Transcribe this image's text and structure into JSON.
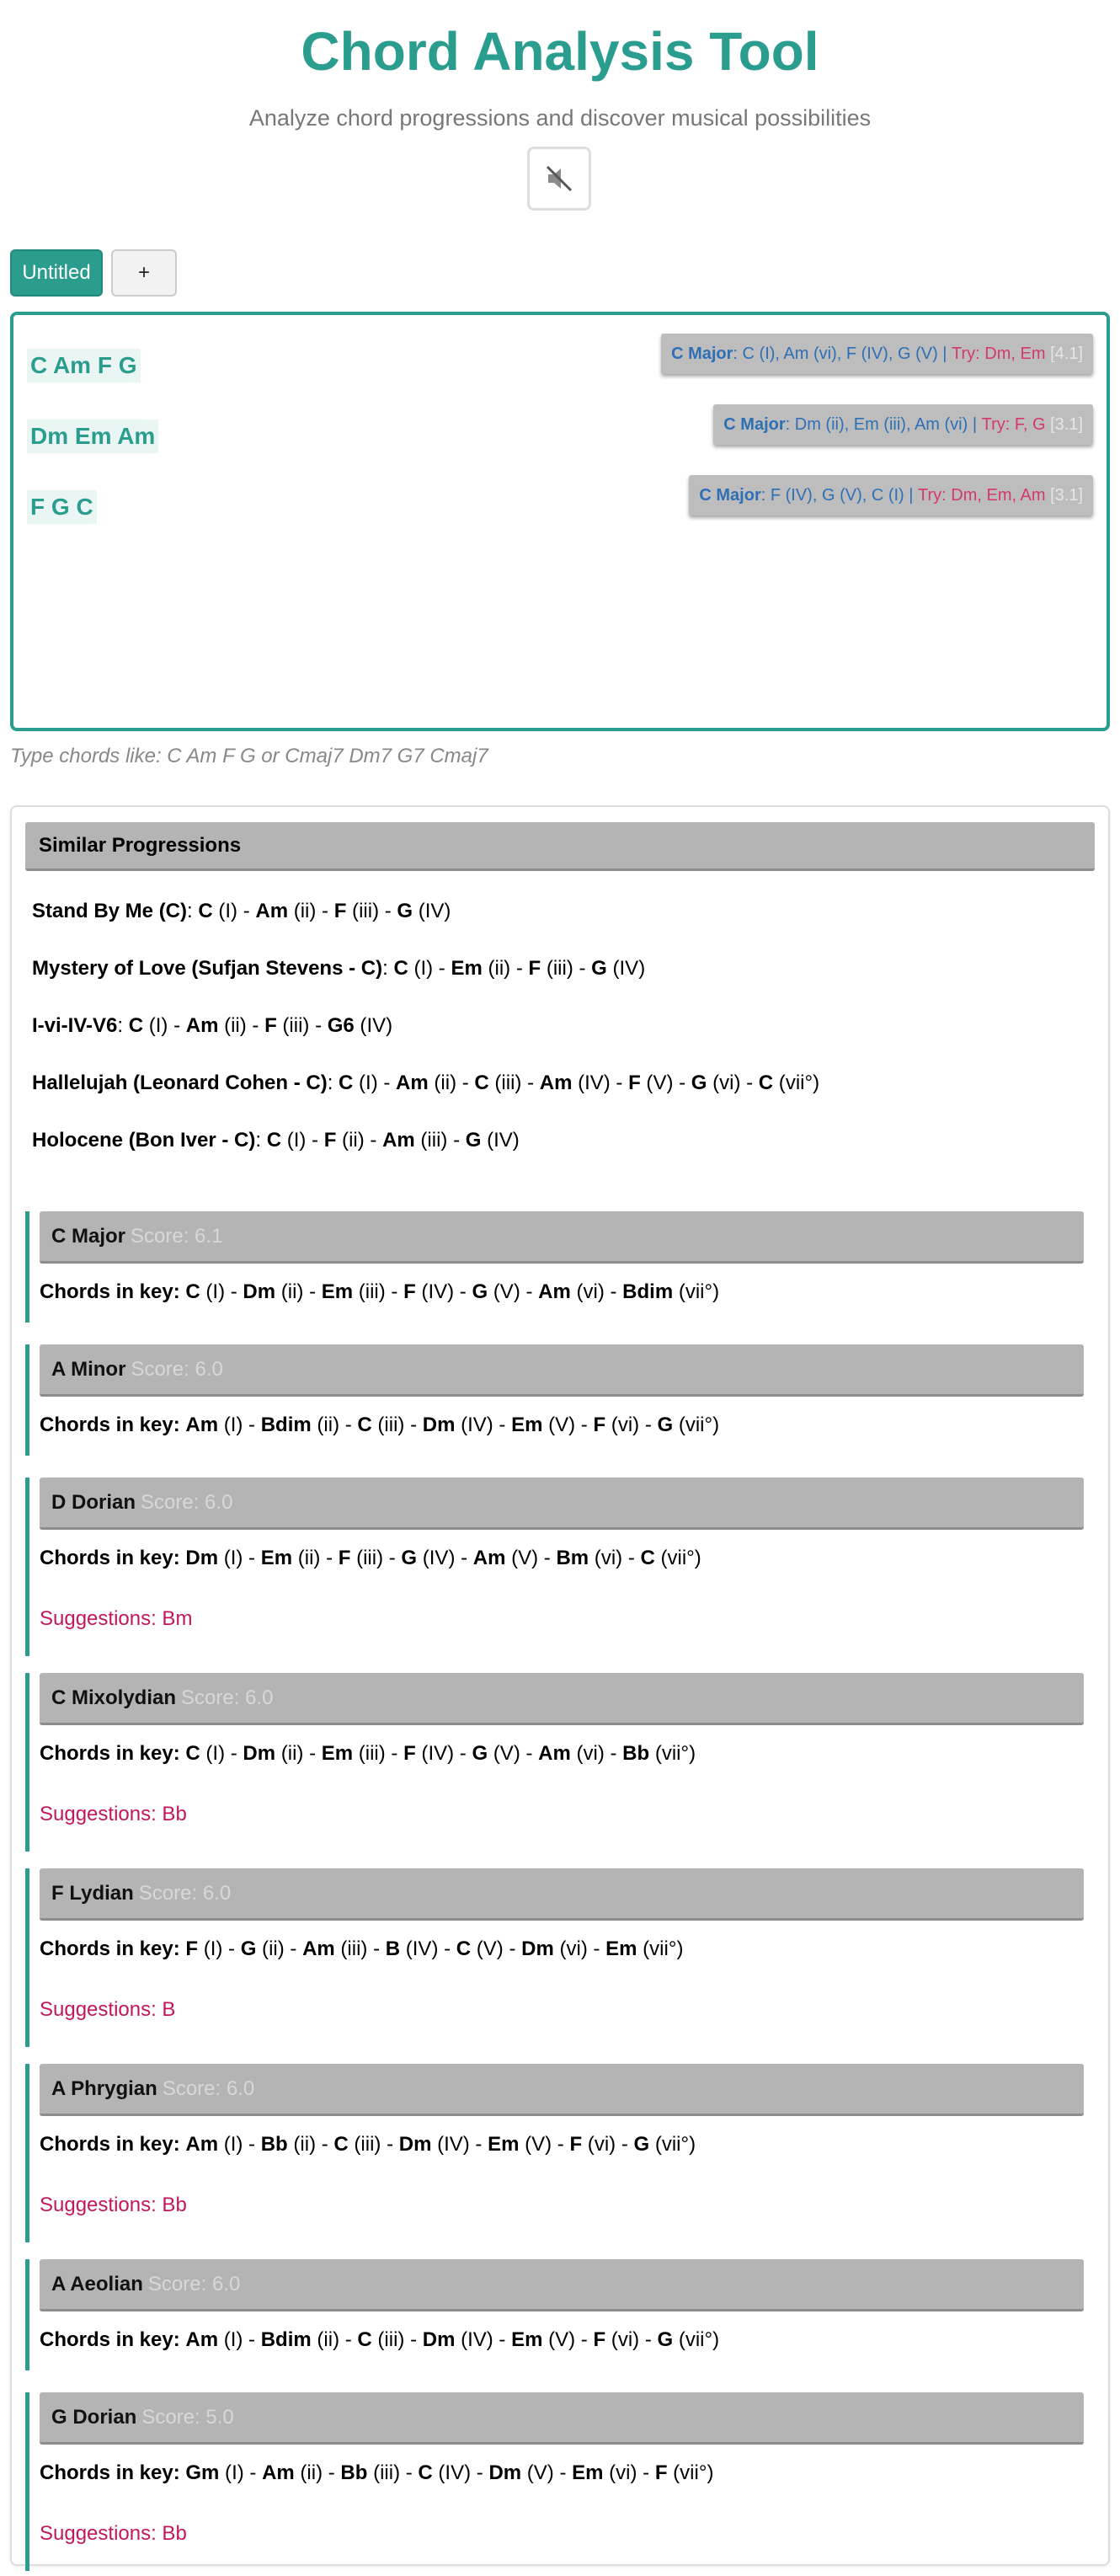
{
  "header": {
    "title": "Chord Analysis Tool",
    "subtitle": "Analyze chord progressions and discover musical possibilities",
    "mute_icon": "speaker-muted-icon"
  },
  "tabs": [
    {
      "label": "Untitled",
      "active": true
    },
    {
      "label": "+",
      "active": false
    }
  ],
  "editor": {
    "lines": [
      {
        "chords": "C Am F G",
        "key": "C Major",
        "analysis": ": C (I), Am (vi), F (IV), G (V) | ",
        "try": "Try: Dm, Em",
        "score": " [4.1]"
      },
      {
        "chords": "Dm Em Am",
        "key": "C Major",
        "analysis": ": Dm (ii), Em (iii), Am (vi) | ",
        "try": "Try: F, G",
        "score": " [3.1]"
      },
      {
        "chords": "F G C",
        "key": "C Major",
        "analysis": ": F (IV), G (V), C (I) | ",
        "try": "Try: Dm, Em, Am",
        "score": " [3.1]"
      }
    ],
    "hint": "Type chords like: C Am F G or Cmaj7 Dm7 G7 Cmaj7"
  },
  "similar": {
    "title": "Similar Progressions",
    "items": [
      {
        "name": "Stand By Me (C)",
        "chords": [
          {
            "c": "C",
            "n": "I"
          },
          {
            "c": "Am",
            "n": "ii"
          },
          {
            "c": "F",
            "n": "iii"
          },
          {
            "c": "G",
            "n": "IV"
          }
        ]
      },
      {
        "name": "Mystery of Love (Sufjan Stevens - C)",
        "chords": [
          {
            "c": "C",
            "n": "I"
          },
          {
            "c": "Em",
            "n": "ii"
          },
          {
            "c": "F",
            "n": "iii"
          },
          {
            "c": "G",
            "n": "IV"
          }
        ]
      },
      {
        "name": "I-vi-IV-V6",
        "chords": [
          {
            "c": "C",
            "n": "I"
          },
          {
            "c": "Am",
            "n": "ii"
          },
          {
            "c": "F",
            "n": "iii"
          },
          {
            "c": "G6",
            "n": "IV"
          }
        ]
      },
      {
        "name": "Hallelujah (Leonard Cohen - C)",
        "chords": [
          {
            "c": "C",
            "n": "I"
          },
          {
            "c": "Am",
            "n": "ii"
          },
          {
            "c": "C",
            "n": "iii"
          },
          {
            "c": "Am",
            "n": "IV"
          },
          {
            "c": "F",
            "n": "V"
          },
          {
            "c": "G",
            "n": "vi"
          },
          {
            "c": "C",
            "n": "vii°"
          }
        ]
      },
      {
        "name": "Holocene (Bon Iver - C)",
        "chords": [
          {
            "c": "C",
            "n": "I"
          },
          {
            "c": "F",
            "n": "ii"
          },
          {
            "c": "Am",
            "n": "iii"
          },
          {
            "c": "G",
            "n": "IV"
          }
        ]
      }
    ]
  },
  "keys_label": "Chords in key:",
  "keys": [
    {
      "name": "C Major",
      "score": "Score: 6.1",
      "chords": [
        {
          "c": "C",
          "n": "I"
        },
        {
          "c": "Dm",
          "n": "ii"
        },
        {
          "c": "Em",
          "n": "iii"
        },
        {
          "c": "F",
          "n": "IV"
        },
        {
          "c": "G",
          "n": "V"
        },
        {
          "c": "Am",
          "n": "vi"
        },
        {
          "c": "Bdim",
          "n": "vii°"
        }
      ],
      "suggestions": ""
    },
    {
      "name": "A Minor",
      "score": "Score: 6.0",
      "chords": [
        {
          "c": "Am",
          "n": "I"
        },
        {
          "c": "Bdim",
          "n": "ii"
        },
        {
          "c": "C",
          "n": "iii"
        },
        {
          "c": "Dm",
          "n": "IV"
        },
        {
          "c": "Em",
          "n": "V"
        },
        {
          "c": "F",
          "n": "vi"
        },
        {
          "c": "G",
          "n": "vii°"
        }
      ],
      "suggestions": ""
    },
    {
      "name": "D Dorian",
      "score": "Score: 6.0",
      "chords": [
        {
          "c": "Dm",
          "n": "I"
        },
        {
          "c": "Em",
          "n": "ii"
        },
        {
          "c": "F",
          "n": "iii"
        },
        {
          "c": "G",
          "n": "IV"
        },
        {
          "c": "Am",
          "n": "V"
        },
        {
          "c": "Bm",
          "n": "vi"
        },
        {
          "c": "C",
          "n": "vii°"
        }
      ],
      "suggestions": "Suggestions: Bm"
    },
    {
      "name": "C Mixolydian",
      "score": "Score: 6.0",
      "chords": [
        {
          "c": "C",
          "n": "I"
        },
        {
          "c": "Dm",
          "n": "ii"
        },
        {
          "c": "Em",
          "n": "iii"
        },
        {
          "c": "F",
          "n": "IV"
        },
        {
          "c": "G",
          "n": "V"
        },
        {
          "c": "Am",
          "n": "vi"
        },
        {
          "c": "Bb",
          "n": "vii°"
        }
      ],
      "suggestions": "Suggestions: Bb"
    },
    {
      "name": "F Lydian",
      "score": "Score: 6.0",
      "chords": [
        {
          "c": "F",
          "n": "I"
        },
        {
          "c": "G",
          "n": "ii"
        },
        {
          "c": "Am",
          "n": "iii"
        },
        {
          "c": "B",
          "n": "IV"
        },
        {
          "c": "C",
          "n": "V"
        },
        {
          "c": "Dm",
          "n": "vi"
        },
        {
          "c": "Em",
          "n": "vii°"
        }
      ],
      "suggestions": "Suggestions: B"
    },
    {
      "name": "A Phrygian",
      "score": "Score: 6.0",
      "chords": [
        {
          "c": "Am",
          "n": "I"
        },
        {
          "c": "Bb",
          "n": "ii"
        },
        {
          "c": "C",
          "n": "iii"
        },
        {
          "c": "Dm",
          "n": "IV"
        },
        {
          "c": "Em",
          "n": "V"
        },
        {
          "c": "F",
          "n": "vi"
        },
        {
          "c": "G",
          "n": "vii°"
        }
      ],
      "suggestions": "Suggestions: Bb"
    },
    {
      "name": "A Aeolian",
      "score": "Score: 6.0",
      "chords": [
        {
          "c": "Am",
          "n": "I"
        },
        {
          "c": "Bdim",
          "n": "ii"
        },
        {
          "c": "C",
          "n": "iii"
        },
        {
          "c": "Dm",
          "n": "IV"
        },
        {
          "c": "Em",
          "n": "V"
        },
        {
          "c": "F",
          "n": "vi"
        },
        {
          "c": "G",
          "n": "vii°"
        }
      ],
      "suggestions": ""
    },
    {
      "name": "G Dorian",
      "score": "Score: 5.0",
      "chords": [
        {
          "c": "Gm",
          "n": "I"
        },
        {
          "c": "Am",
          "n": "ii"
        },
        {
          "c": "Bb",
          "n": "iii"
        },
        {
          "c": "C",
          "n": "IV"
        },
        {
          "c": "Dm",
          "n": "V"
        },
        {
          "c": "Em",
          "n": "vi"
        },
        {
          "c": "F",
          "n": "vii°"
        }
      ],
      "suggestions": "Suggestions: Bb"
    }
  ],
  "colors": {
    "accent": "#2a9d8f",
    "header_bg": "#b4b4b4",
    "suggestion": "#c2185b",
    "analysis": "#2e6fb5"
  }
}
